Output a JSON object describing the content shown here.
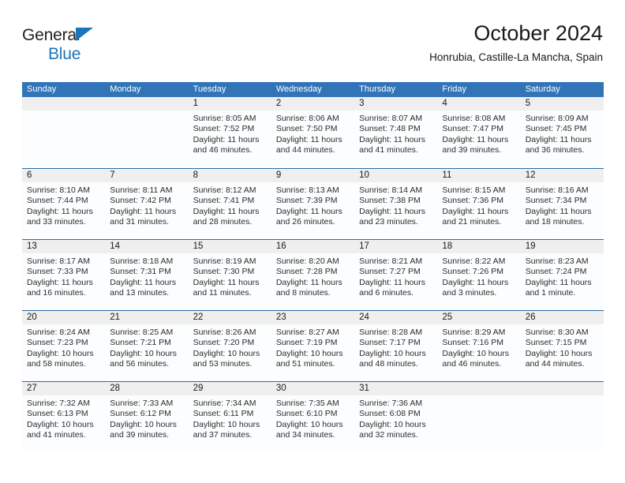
{
  "brand": {
    "line1": "General",
    "line2": "Blue",
    "triangle_color": "#1b75bb"
  },
  "header": {
    "title": "October 2024",
    "subtitle": "Honrubia, Castille-La Mancha, Spain"
  },
  "theme": {
    "header_blue": "#3175b8",
    "row_divider_blue": "#2e6da4",
    "daynum_bg": "#efefef",
    "cell_bg": "#fcfdfe"
  },
  "weekdays": [
    "Sunday",
    "Monday",
    "Tuesday",
    "Wednesday",
    "Thursday",
    "Friday",
    "Saturday"
  ],
  "labels": {
    "sunrise_prefix": "Sunrise:",
    "sunset_prefix": "Sunset:",
    "daylight_prefix": "Daylight:"
  },
  "weeks": [
    [
      {
        "day": ""
      },
      {
        "day": ""
      },
      {
        "day": "1",
        "sunrise": "Sunrise: 8:05 AM",
        "sunset": "Sunset: 7:52 PM",
        "daylight": "Daylight: 11 hours and 46 minutes."
      },
      {
        "day": "2",
        "sunrise": "Sunrise: 8:06 AM",
        "sunset": "Sunset: 7:50 PM",
        "daylight": "Daylight: 11 hours and 44 minutes."
      },
      {
        "day": "3",
        "sunrise": "Sunrise: 8:07 AM",
        "sunset": "Sunset: 7:48 PM",
        "daylight": "Daylight: 11 hours and 41 minutes."
      },
      {
        "day": "4",
        "sunrise": "Sunrise: 8:08 AM",
        "sunset": "Sunset: 7:47 PM",
        "daylight": "Daylight: 11 hours and 39 minutes."
      },
      {
        "day": "5",
        "sunrise": "Sunrise: 8:09 AM",
        "sunset": "Sunset: 7:45 PM",
        "daylight": "Daylight: 11 hours and 36 minutes."
      }
    ],
    [
      {
        "day": "6",
        "sunrise": "Sunrise: 8:10 AM",
        "sunset": "Sunset: 7:44 PM",
        "daylight": "Daylight: 11 hours and 33 minutes."
      },
      {
        "day": "7",
        "sunrise": "Sunrise: 8:11 AM",
        "sunset": "Sunset: 7:42 PM",
        "daylight": "Daylight: 11 hours and 31 minutes."
      },
      {
        "day": "8",
        "sunrise": "Sunrise: 8:12 AM",
        "sunset": "Sunset: 7:41 PM",
        "daylight": "Daylight: 11 hours and 28 minutes."
      },
      {
        "day": "9",
        "sunrise": "Sunrise: 8:13 AM",
        "sunset": "Sunset: 7:39 PM",
        "daylight": "Daylight: 11 hours and 26 minutes."
      },
      {
        "day": "10",
        "sunrise": "Sunrise: 8:14 AM",
        "sunset": "Sunset: 7:38 PM",
        "daylight": "Daylight: 11 hours and 23 minutes."
      },
      {
        "day": "11",
        "sunrise": "Sunrise: 8:15 AM",
        "sunset": "Sunset: 7:36 PM",
        "daylight": "Daylight: 11 hours and 21 minutes."
      },
      {
        "day": "12",
        "sunrise": "Sunrise: 8:16 AM",
        "sunset": "Sunset: 7:34 PM",
        "daylight": "Daylight: 11 hours and 18 minutes."
      }
    ],
    [
      {
        "day": "13",
        "sunrise": "Sunrise: 8:17 AM",
        "sunset": "Sunset: 7:33 PM",
        "daylight": "Daylight: 11 hours and 16 minutes."
      },
      {
        "day": "14",
        "sunrise": "Sunrise: 8:18 AM",
        "sunset": "Sunset: 7:31 PM",
        "daylight": "Daylight: 11 hours and 13 minutes."
      },
      {
        "day": "15",
        "sunrise": "Sunrise: 8:19 AM",
        "sunset": "Sunset: 7:30 PM",
        "daylight": "Daylight: 11 hours and 11 minutes."
      },
      {
        "day": "16",
        "sunrise": "Sunrise: 8:20 AM",
        "sunset": "Sunset: 7:28 PM",
        "daylight": "Daylight: 11 hours and 8 minutes."
      },
      {
        "day": "17",
        "sunrise": "Sunrise: 8:21 AM",
        "sunset": "Sunset: 7:27 PM",
        "daylight": "Daylight: 11 hours and 6 minutes."
      },
      {
        "day": "18",
        "sunrise": "Sunrise: 8:22 AM",
        "sunset": "Sunset: 7:26 PM",
        "daylight": "Daylight: 11 hours and 3 minutes."
      },
      {
        "day": "19",
        "sunrise": "Sunrise: 8:23 AM",
        "sunset": "Sunset: 7:24 PM",
        "daylight": "Daylight: 11 hours and 1 minute."
      }
    ],
    [
      {
        "day": "20",
        "sunrise": "Sunrise: 8:24 AM",
        "sunset": "Sunset: 7:23 PM",
        "daylight": "Daylight: 10 hours and 58 minutes."
      },
      {
        "day": "21",
        "sunrise": "Sunrise: 8:25 AM",
        "sunset": "Sunset: 7:21 PM",
        "daylight": "Daylight: 10 hours and 56 minutes."
      },
      {
        "day": "22",
        "sunrise": "Sunrise: 8:26 AM",
        "sunset": "Sunset: 7:20 PM",
        "daylight": "Daylight: 10 hours and 53 minutes."
      },
      {
        "day": "23",
        "sunrise": "Sunrise: 8:27 AM",
        "sunset": "Sunset: 7:19 PM",
        "daylight": "Daylight: 10 hours and 51 minutes."
      },
      {
        "day": "24",
        "sunrise": "Sunrise: 8:28 AM",
        "sunset": "Sunset: 7:17 PM",
        "daylight": "Daylight: 10 hours and 48 minutes."
      },
      {
        "day": "25",
        "sunrise": "Sunrise: 8:29 AM",
        "sunset": "Sunset: 7:16 PM",
        "daylight": "Daylight: 10 hours and 46 minutes."
      },
      {
        "day": "26",
        "sunrise": "Sunrise: 8:30 AM",
        "sunset": "Sunset: 7:15 PM",
        "daylight": "Daylight: 10 hours and 44 minutes."
      }
    ],
    [
      {
        "day": "27",
        "sunrise": "Sunrise: 7:32 AM",
        "sunset": "Sunset: 6:13 PM",
        "daylight": "Daylight: 10 hours and 41 minutes."
      },
      {
        "day": "28",
        "sunrise": "Sunrise: 7:33 AM",
        "sunset": "Sunset: 6:12 PM",
        "daylight": "Daylight: 10 hours and 39 minutes."
      },
      {
        "day": "29",
        "sunrise": "Sunrise: 7:34 AM",
        "sunset": "Sunset: 6:11 PM",
        "daylight": "Daylight: 10 hours and 37 minutes."
      },
      {
        "day": "30",
        "sunrise": "Sunrise: 7:35 AM",
        "sunset": "Sunset: 6:10 PM",
        "daylight": "Daylight: 10 hours and 34 minutes."
      },
      {
        "day": "31",
        "sunrise": "Sunrise: 7:36 AM",
        "sunset": "Sunset: 6:08 PM",
        "daylight": "Daylight: 10 hours and 32 minutes."
      },
      {
        "day": ""
      },
      {
        "day": ""
      }
    ]
  ]
}
